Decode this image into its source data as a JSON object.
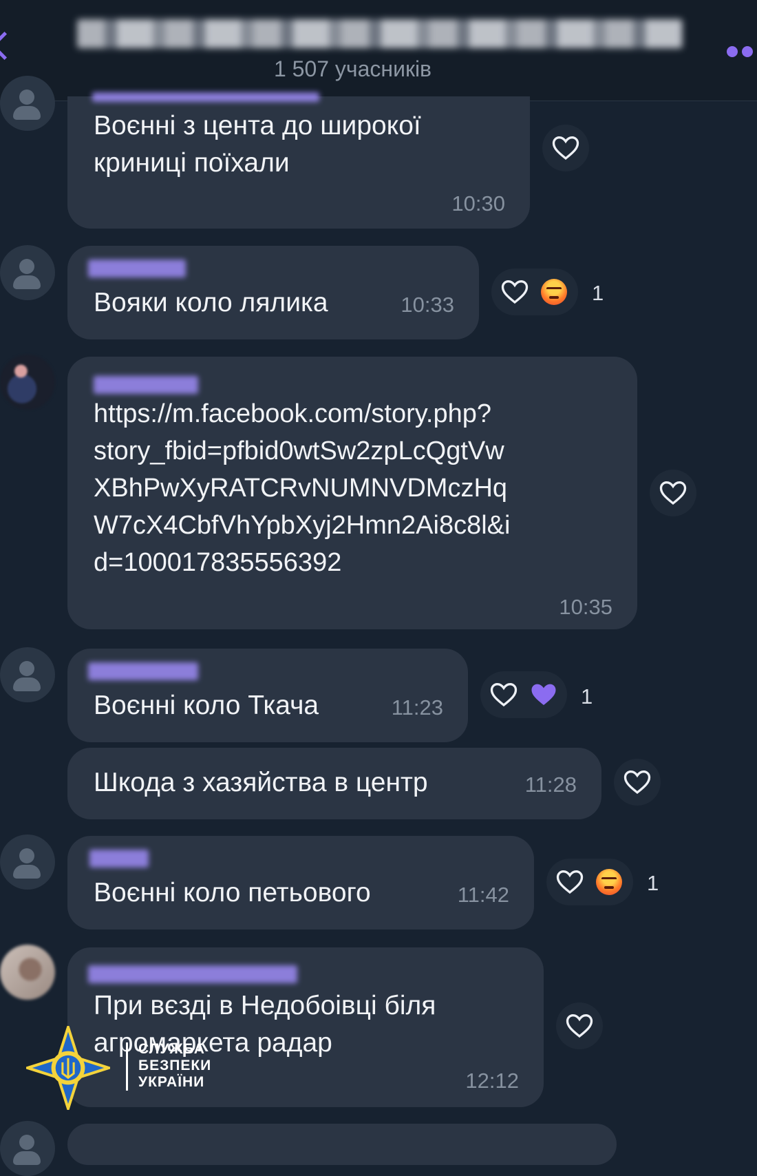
{
  "header": {
    "participants": "1 507 учасників"
  },
  "messages": [
    {
      "text": "Воєнні з цента до широкої\nкриниці поїхали",
      "time": "10:30"
    },
    {
      "text": "Вояки коло лялика",
      "time": "10:33",
      "reaction_count": "1"
    },
    {
      "text": "https://m.facebook.com/story.php?\nstory_fbid=pfbid0wtSw2zpLcQgtVw\nXBhPwXyRATCRvNUMNVDMczHq\nW7cX4CbfVhYpbXyj2Hmn2Ai8c8l&i\nd=100017835556392",
      "time": "10:35"
    },
    {
      "text": "Воєнні коло Ткача",
      "time": "11:23",
      "reaction_count": "1"
    },
    {
      "text": "Шкода з хазяйства в центр",
      "time": "11:28"
    },
    {
      "text": "Воєнні коло петьового",
      "time": "11:42",
      "reaction_count": "1"
    },
    {
      "text": "При вєзді в Недобоівці біля\nагромаркета радар",
      "time": "12:12"
    }
  ],
  "watermark": {
    "line1": "СЛУЖБА",
    "line2": "БЕЗПЕКИ",
    "line3": "УКРАЇНИ"
  },
  "colors": {
    "background": "#172230",
    "bubble": "#2b3544",
    "accent": "#8b6cf0"
  },
  "icons": [
    "back-arrow-icon",
    "more-dots-icon",
    "heart-icon",
    "angry-emoji-icon",
    "purple-heart-icon",
    "default-avatar-icon"
  ]
}
